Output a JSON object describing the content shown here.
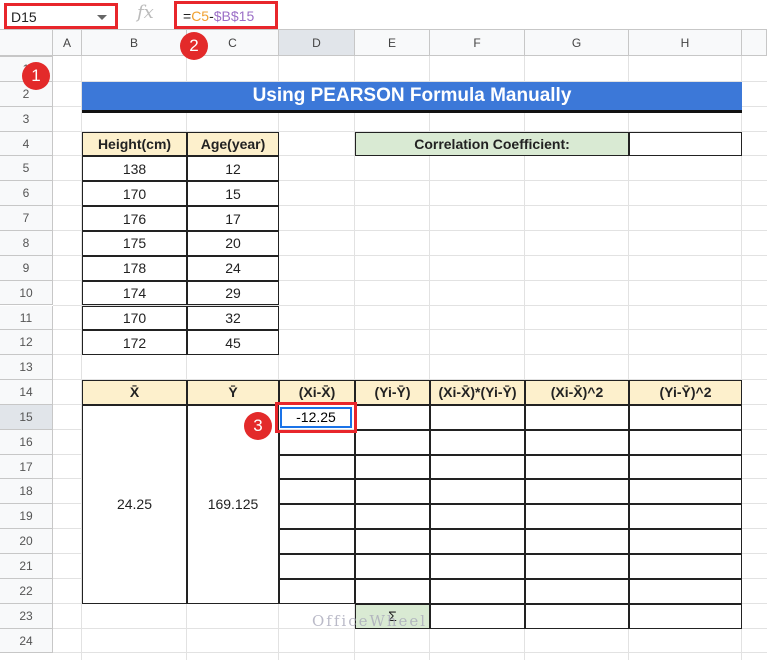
{
  "formula_bar": {
    "name_box": "D15",
    "fx": "fx",
    "formula_eq": "=",
    "formula_ref1": "C5",
    "formula_op": "-",
    "formula_ref2": "$B$15"
  },
  "columns": [
    "A",
    "B",
    "C",
    "D",
    "E",
    "F",
    "G",
    "H"
  ],
  "rows": [
    "1",
    "2",
    "3",
    "4",
    "5",
    "6",
    "7",
    "8",
    "9",
    "10",
    "11",
    "12",
    "13",
    "14",
    "15",
    "16",
    "17",
    "18",
    "19",
    "20",
    "21",
    "22",
    "23",
    "24"
  ],
  "selected_cell": {
    "column": "D",
    "row": "15"
  },
  "title": "Using PEARSON Formula Manually",
  "data_table": {
    "headers": [
      "Height(cm)",
      "Age(year)"
    ],
    "rows": [
      [
        "138",
        "12"
      ],
      [
        "170",
        "15"
      ],
      [
        "176",
        "17"
      ],
      [
        "175",
        "20"
      ],
      [
        "178",
        "24"
      ],
      [
        "174",
        "29"
      ],
      [
        "170",
        "32"
      ],
      [
        "172",
        "45"
      ]
    ]
  },
  "correlation": {
    "label": "Correlation Coefficient:",
    "value": ""
  },
  "calc_table": {
    "headers": [
      "X̄",
      "Ȳ",
      "(Xi-X̄)",
      "(Yi-Ȳ)",
      "(Xi-X̄)*(Yi-Ȳ)",
      "(Xi-X̄)^2",
      "(Yi-Ȳ)^2"
    ],
    "x_mean": "24.25",
    "y_mean": "169.125",
    "active_value": "-12.25",
    "sum_symbol": "Σ"
  },
  "badges": [
    "1",
    "2",
    "3"
  ],
  "watermark": "OfficeWheel",
  "colors": {
    "title_bg": "#3c78d8",
    "header_bg": "#fdf0cc",
    "green_bg": "#d9ead3",
    "highlight": "#e8262b",
    "selection": "#1a73e8"
  }
}
